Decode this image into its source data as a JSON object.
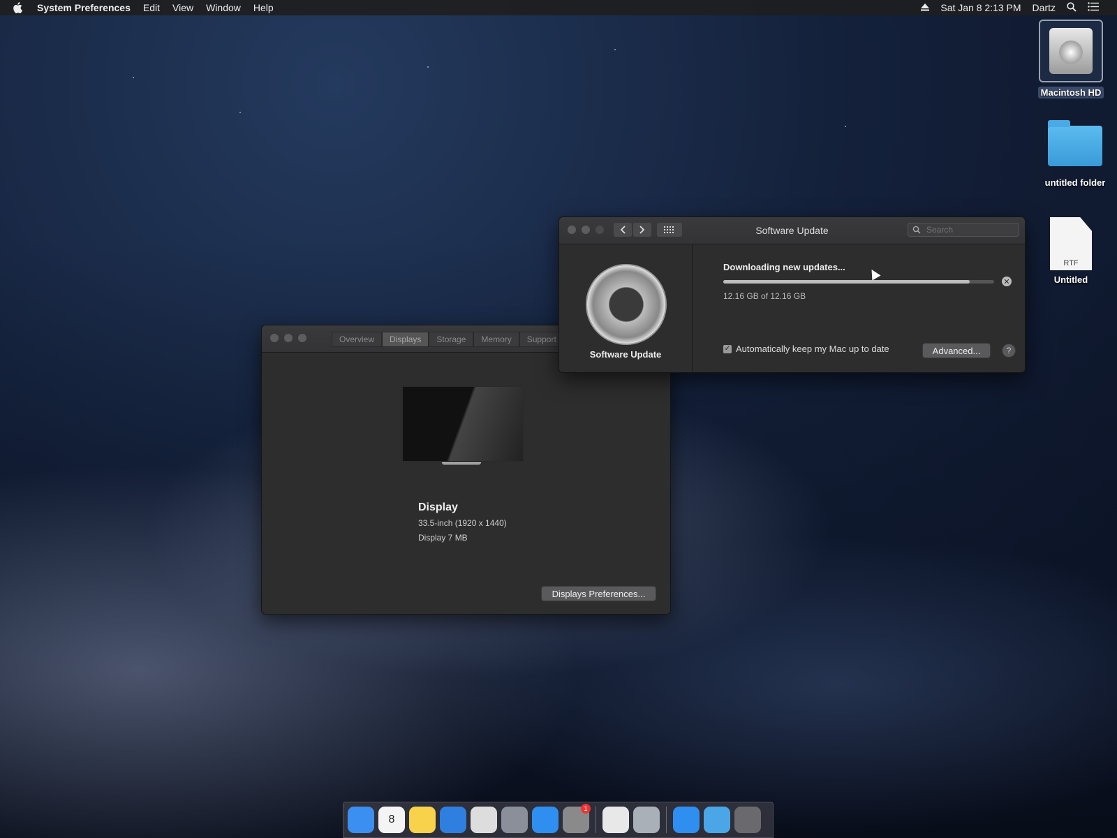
{
  "menubar": {
    "app_name": "System Preferences",
    "menus": [
      "Edit",
      "View",
      "Window",
      "Help"
    ],
    "datetime": "Sat Jan 8  2:13 PM",
    "user": "Dartz"
  },
  "desktop": {
    "items": [
      {
        "label": "Macintosh HD",
        "icon": "hard-drive-icon"
      },
      {
        "label": "untitled folder",
        "icon": "folder-icon"
      },
      {
        "label": "Untitled",
        "icon": "rtf-document-icon",
        "badge": "RTF"
      }
    ]
  },
  "about_window": {
    "tabs": [
      "Overview",
      "Displays",
      "Storage",
      "Memory",
      "Support"
    ],
    "active_tab": "Displays",
    "display_title": "Display",
    "display_size": "33.5-inch (1920 x 1440)",
    "display_memory": "Display 7 MB",
    "prefs_button": "Displays Preferences..."
  },
  "software_update": {
    "title": "Software Update",
    "search_placeholder": "Search",
    "side_label": "Software Update",
    "status": "Downloading new updates...",
    "progress": 0.91,
    "size_text": "12.16 GB of 12.16 GB",
    "auto_update_label": "Automatically keep my Mac up to date",
    "auto_update_checked": true,
    "advanced_button": "Advanced...",
    "help_label": "?"
  },
  "dock": {
    "apps": [
      {
        "name": "finder",
        "color": "#3b8ff0"
      },
      {
        "name": "calendar",
        "color": "#f4f4f4",
        "text": "8"
      },
      {
        "name": "notes",
        "color": "#f7d24a"
      },
      {
        "name": "safari",
        "color": "#2f7fe0"
      },
      {
        "name": "chrome",
        "color": "#dddddd"
      },
      {
        "name": "launchpad",
        "color": "#8a8f9a"
      },
      {
        "name": "app-store",
        "color": "#2f8ff0"
      },
      {
        "name": "system-preferences",
        "color": "#8a8a8a",
        "badge": "1"
      },
      {
        "name": "textedit",
        "color": "#e8e8e8"
      },
      {
        "name": "utilities",
        "color": "#a9b0b8"
      },
      {
        "name": "app-store-2",
        "color": "#2f8ff0"
      },
      {
        "name": "downloads-folder",
        "color": "#4aa6e6"
      },
      {
        "name": "trash",
        "color": "#6a6a6e"
      }
    ]
  }
}
